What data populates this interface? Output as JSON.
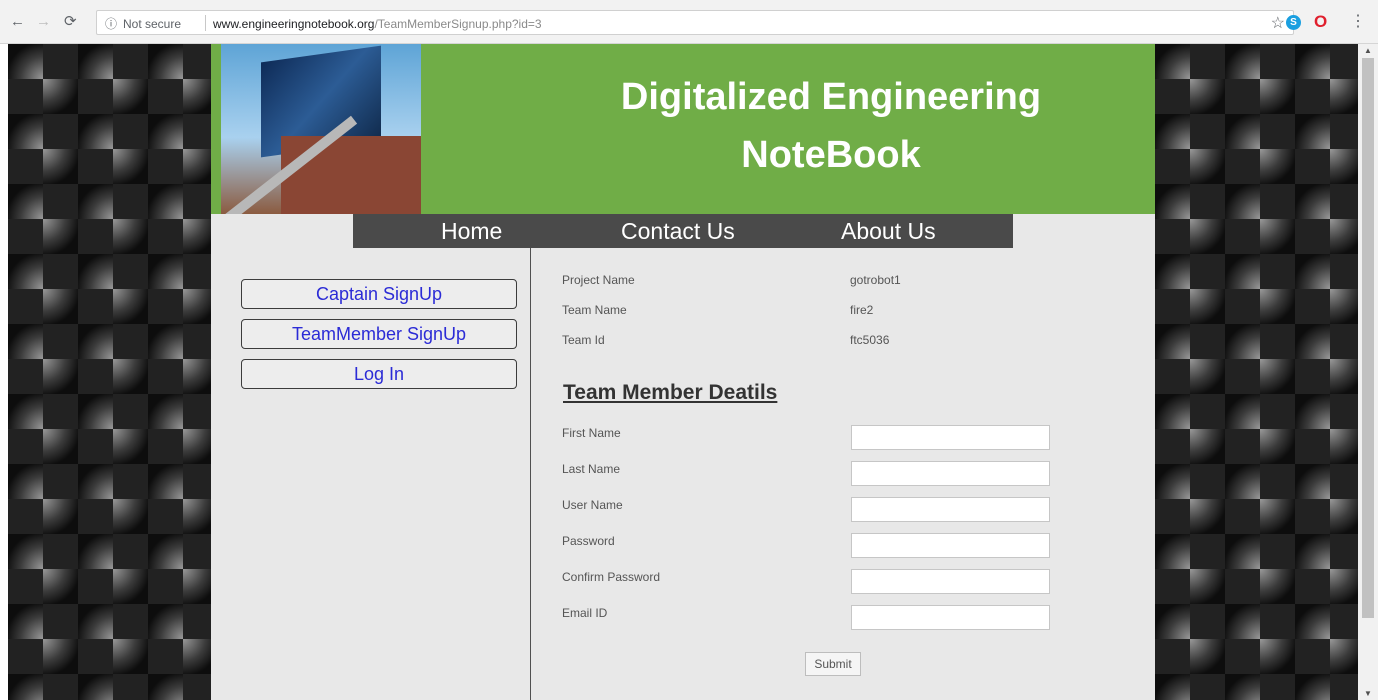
{
  "browser": {
    "security_label": "Not secure",
    "url_host": "www.engineeringnotebook.org",
    "url_path": "/TeamMemberSignup.php?id=3"
  },
  "site": {
    "title": "Digitalized Engineering NoteBook",
    "nav": [
      {
        "label": "Home"
      },
      {
        "label": "Contact Us"
      },
      {
        "label": "About Us"
      }
    ],
    "sidebar": {
      "captain_signup": "Captain SignUp",
      "teammember_signup": "TeamMember SignUp",
      "login": "Log In"
    },
    "team_info": [
      {
        "label": "Project Name",
        "value": "gotrobot1"
      },
      {
        "label": "Team Name",
        "value": "fire2"
      },
      {
        "label": "Team Id",
        "value": "ftc5036"
      }
    ],
    "form": {
      "heading": "Team Member Deatils",
      "fields": [
        {
          "label": "First Name",
          "value": ""
        },
        {
          "label": "Last Name",
          "value": ""
        },
        {
          "label": "User Name",
          "value": ""
        },
        {
          "label": "Password",
          "value": ""
        },
        {
          "label": "Confirm Password",
          "value": ""
        },
        {
          "label": "Email ID",
          "value": ""
        }
      ],
      "submit_label": "Submit"
    }
  },
  "colors": {
    "banner": "#70ad47",
    "navbar": "#4a4a4a",
    "page": "#e8e8e8",
    "sidebar_link": "#2b2bd6"
  }
}
